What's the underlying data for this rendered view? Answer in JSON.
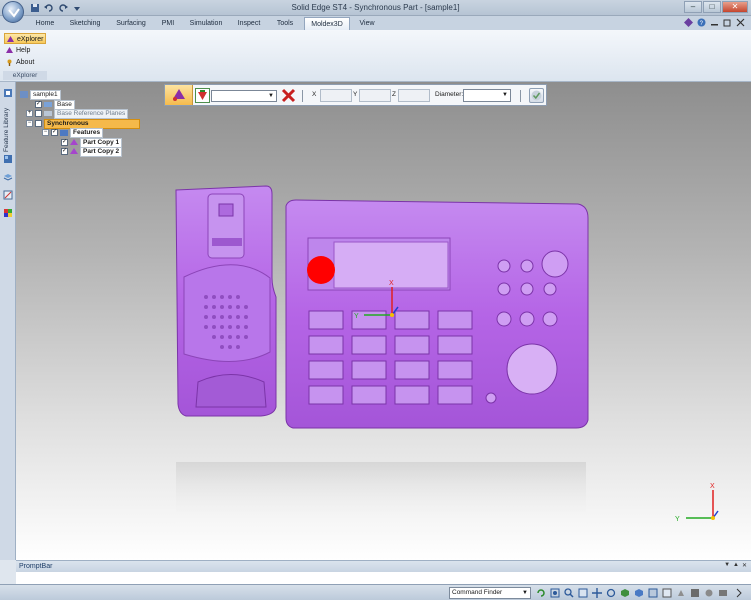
{
  "window": {
    "title": "Solid Edge ST4 - Synchronous Part - [sample1]"
  },
  "tabs": [
    {
      "label": "Home"
    },
    {
      "label": "Sketching"
    },
    {
      "label": "Surfacing"
    },
    {
      "label": "PMI"
    },
    {
      "label": "Simulation"
    },
    {
      "label": "Inspect"
    },
    {
      "label": "Tools"
    },
    {
      "label": "Moldex3D",
      "active": true
    },
    {
      "label": "View"
    }
  ],
  "ribbon": {
    "items": [
      {
        "label": "eXplorer",
        "icon": "explorer-icon"
      },
      {
        "label": "Help",
        "icon": "help-icon"
      },
      {
        "label": "About",
        "icon": "about-icon"
      }
    ],
    "group_label": "eXplorer"
  },
  "sidebar": {
    "label": "Feature Library"
  },
  "tree": {
    "root": "sample1",
    "base": "Base",
    "base_planes": "Base Reference Planes",
    "synchronous": "Synchronous",
    "features": "Features",
    "part_copy_1": "Part Copy 1",
    "part_copy_2": "Part Copy 2"
  },
  "command_bar": {
    "x_label": "X",
    "y_label": "Y",
    "z_label": "Z",
    "diameter_label": "Diameter:",
    "x_value": "",
    "y_value": "",
    "z_value": "",
    "shape_value": "",
    "diameter_value": ""
  },
  "axes": {
    "x": "X",
    "y": "Y"
  },
  "prompt": {
    "title": "PromptBar",
    "text": ""
  },
  "status": {
    "command_finder": "Command Finder"
  },
  "colors": {
    "part": "#b565e6",
    "marker": "#ff0000",
    "highlight": "#f5b94a"
  }
}
